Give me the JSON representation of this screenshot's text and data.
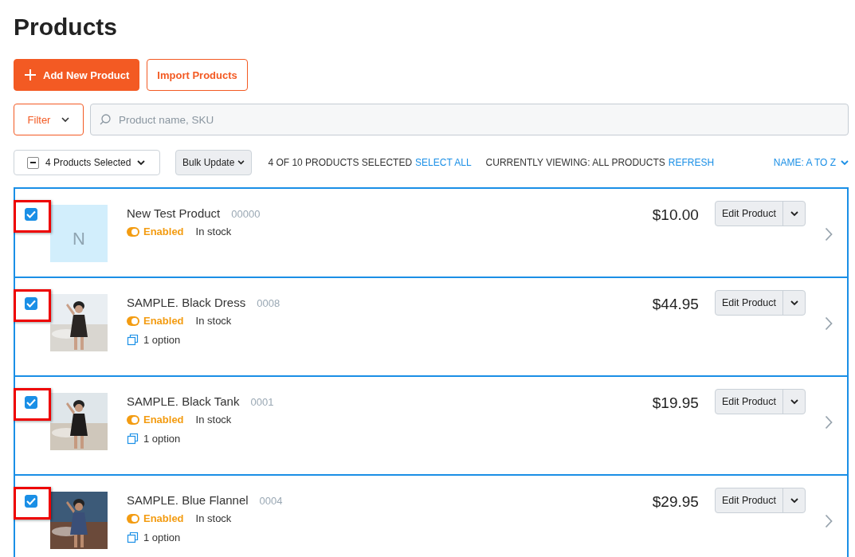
{
  "title": "Products",
  "actions": [
    {
      "label": "Add New Product",
      "kind": "primary"
    },
    {
      "label": "Import Products",
      "kind": "outline"
    }
  ],
  "filter": {
    "label": "Filter"
  },
  "search": {
    "placeholder": "Product name, SKU"
  },
  "toolbar": {
    "selection": "4 Products Selected",
    "bulk": "Bulk Update",
    "count": "4 OF 10 PRODUCTS SELECTED",
    "select_all": "SELECT ALL",
    "viewing": "CURRENTLY VIEWING: ALL PRODUCTS",
    "refresh": "REFRESH",
    "sort": "NAME: A TO Z"
  },
  "products": [
    {
      "name": "New Test Product",
      "sku": "00000",
      "status": "Enabled",
      "stock": "In stock",
      "price": "$10.00",
      "edit": "Edit Product",
      "selected": true,
      "highlighted": true,
      "thumb": {
        "kind": "letter",
        "text": "N"
      }
    },
    {
      "name": "SAMPLE. Black Dress",
      "sku": "0008",
      "status": "Enabled",
      "stock": "In stock",
      "options": "1 option",
      "price": "$44.95",
      "edit": "Edit Product",
      "selected": true,
      "highlighted": true
    },
    {
      "name": "SAMPLE. Black Tank",
      "sku": "0001",
      "status": "Enabled",
      "stock": "In stock",
      "options": "1 option",
      "price": "$19.95",
      "edit": "Edit Product",
      "selected": true,
      "highlighted": true
    },
    {
      "name": "SAMPLE. Blue Flannel",
      "sku": "0004",
      "status": "Enabled",
      "stock": "In stock",
      "options": "1 option",
      "price": "$29.95",
      "edit": "Edit Product",
      "selected": true,
      "highlighted": true
    }
  ]
}
